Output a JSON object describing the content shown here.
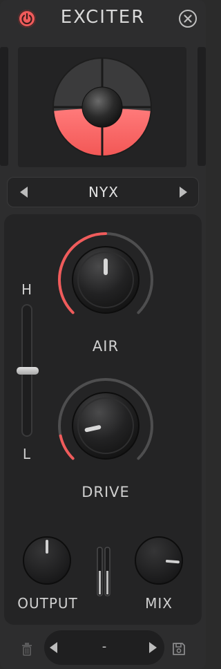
{
  "header": {
    "title": "EXCITER",
    "power_icon": "power-icon",
    "close_icon": "close-icon"
  },
  "preset": {
    "name": "NYX",
    "prev_icon": "triangle-left-icon",
    "next_icon": "triangle-right-icon"
  },
  "controls": {
    "air": {
      "label": "AIR",
      "value": 0.5
    },
    "drive": {
      "label": "DRIVE",
      "value": 0.12
    },
    "output": {
      "label": "OUTPUT",
      "value": 0.5
    },
    "mix": {
      "label": "MIX",
      "value": 0.85
    },
    "band_slider": {
      "high_label": "H",
      "low_label": "L",
      "value": 0.5
    }
  },
  "footer": {
    "preset_value": "-",
    "trash_icon": "trash-icon",
    "save_icon": "save-icon",
    "prev_icon": "triangle-left-icon",
    "next_icon": "triangle-right-icon"
  },
  "colors": {
    "accent": "#f05b5b",
    "background": "#2d2d2e",
    "panel": "#242425",
    "text": "#d9d9d9"
  }
}
